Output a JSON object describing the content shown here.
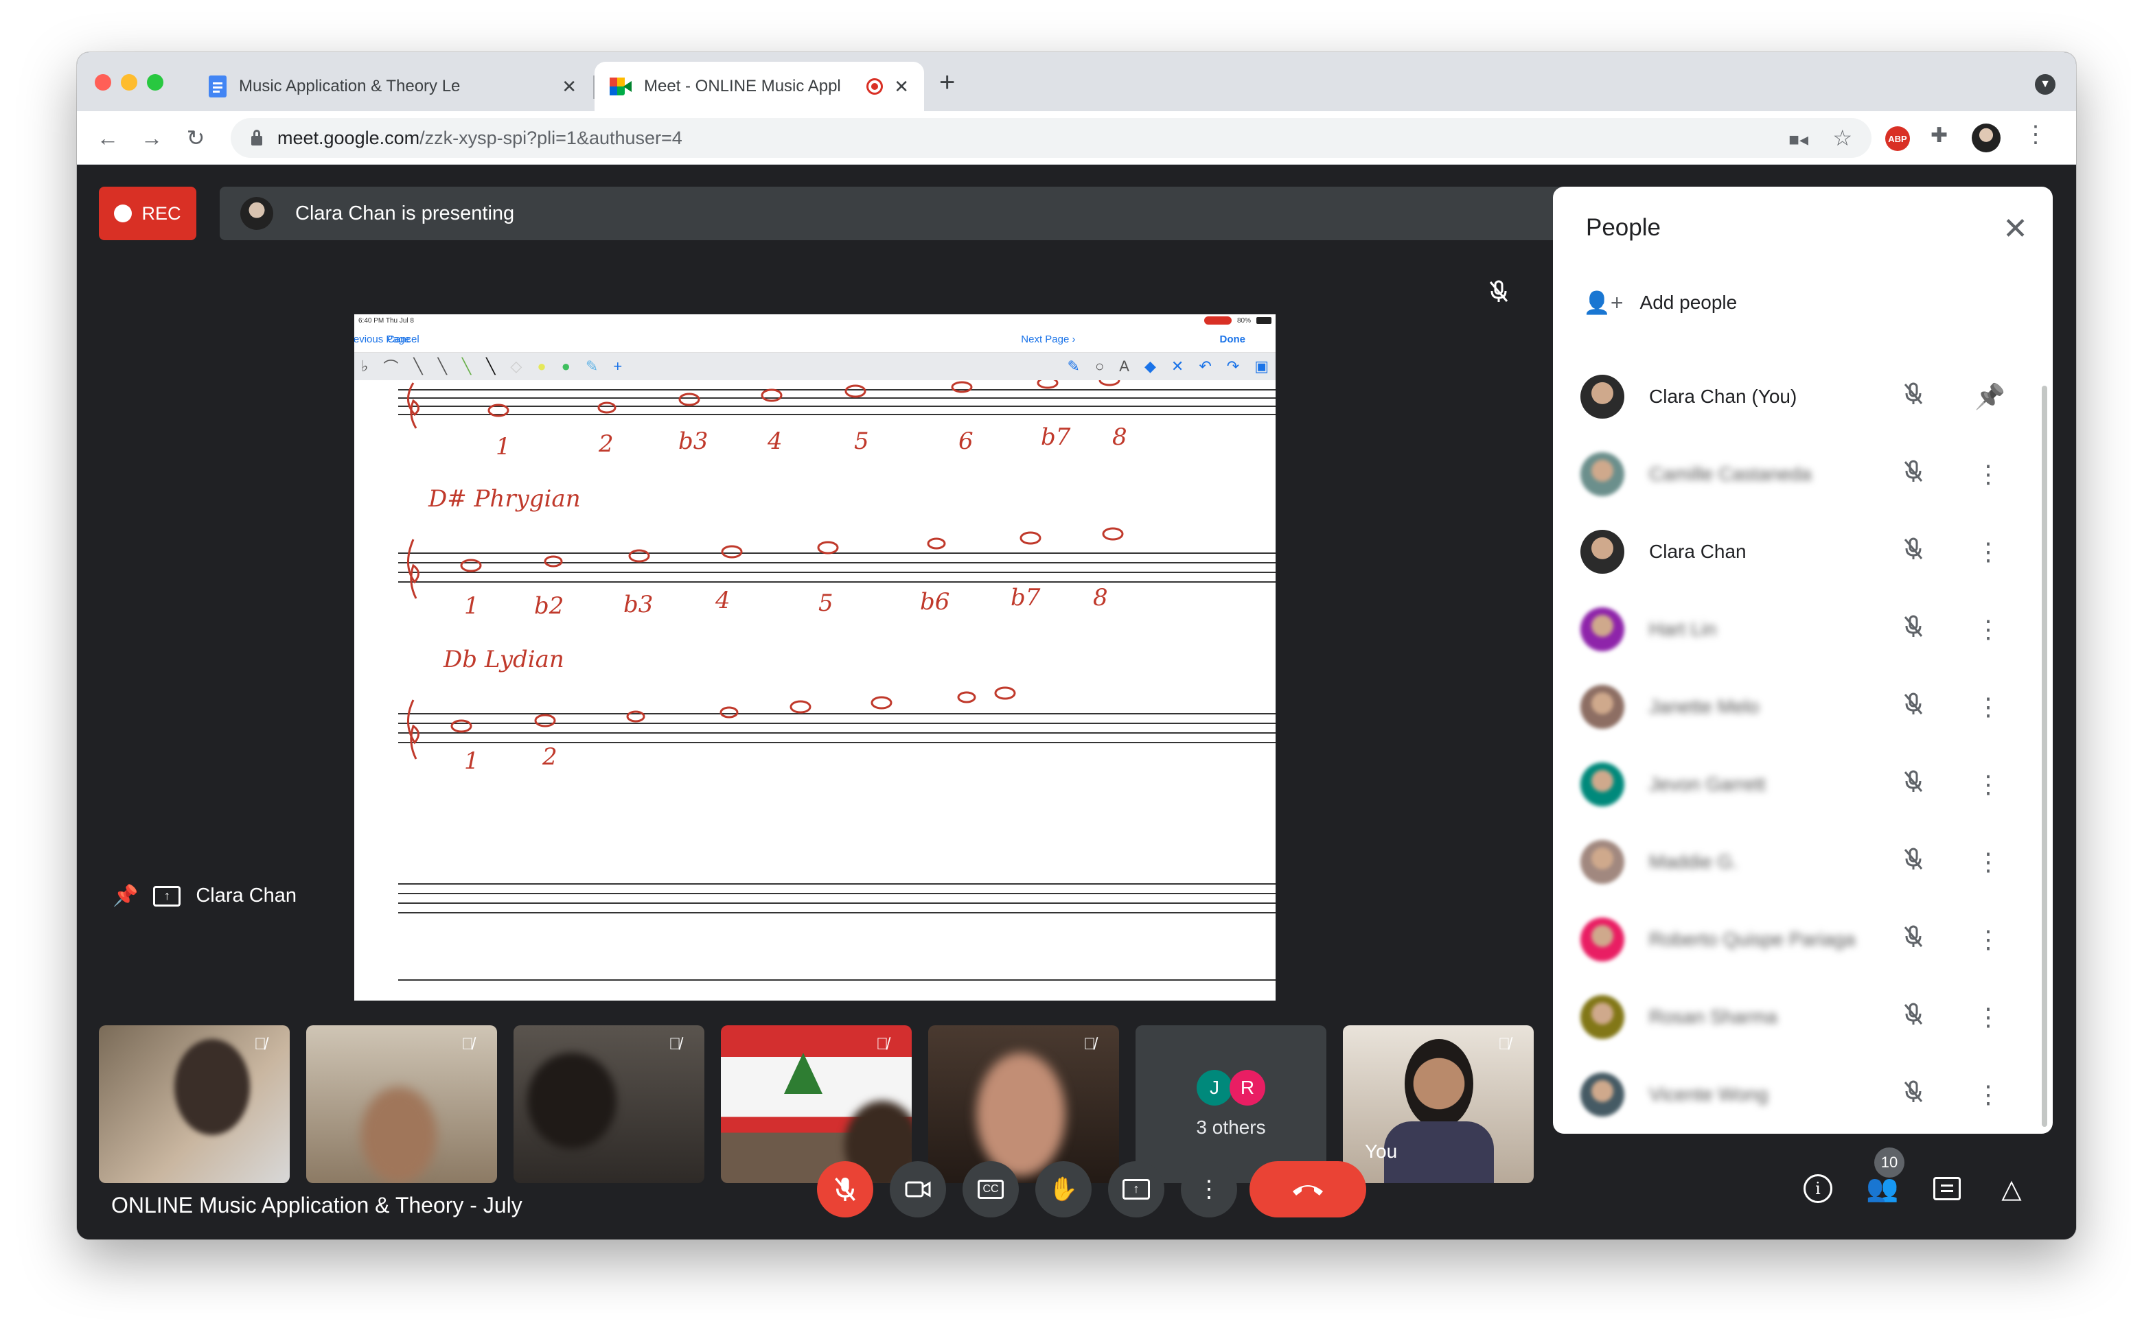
{
  "browser": {
    "tabs": [
      {
        "title": "Music Application & Theory Le",
        "icon": "docs-icon",
        "active": false
      },
      {
        "title": "Meet - ONLINE Music Appl",
        "icon": "meet-icon",
        "active": true
      }
    ],
    "new_tab": "+",
    "url_host": "meet.google.com",
    "url_path": "/zzk-xysp-spi?pli=1&authuser=4",
    "abp_label": "ABP"
  },
  "meet": {
    "rec_label": "REC",
    "presenting_text": "Clara Chan is presenting",
    "presenter_name": "Clara Chan",
    "meeting_title": "ONLINE Music Application & Theory - July",
    "participant_count": "10",
    "others": {
      "initials": [
        "J",
        "R"
      ],
      "label": "3 others"
    },
    "self_tile_label": "You",
    "slide": {
      "status_time": "6:40 PM  Thu Jul 8",
      "status_battery": "80%",
      "cancel": "Cancel",
      "previous": "Previous Page",
      "next": "Next Page",
      "done": "Done",
      "heading_phrygian": "D# Phrygian",
      "heading_lydian": "Db Lydian",
      "row1_degrees": [
        "1",
        "2",
        "b3",
        "4",
        "5",
        "6",
        "b7",
        "8"
      ],
      "row2_degrees": [
        "1",
        "b2",
        "b3",
        "4",
        "5",
        "b6",
        "b7",
        "8"
      ],
      "row3_degrees": [
        "1",
        "2"
      ]
    }
  },
  "people_panel": {
    "title": "People",
    "add_people": "Add people",
    "participants": [
      {
        "name": "Clara Chan (You)",
        "blurred": false,
        "color": "#2b2b2b",
        "action": "pin"
      },
      {
        "name": "Camille Castaneda",
        "blurred": true,
        "color": "#6b8f8c",
        "action": "more"
      },
      {
        "name": "Clara Chan",
        "blurred": false,
        "color": "#2b2b2b",
        "action": "more"
      },
      {
        "name": "Hart Lin",
        "blurred": true,
        "color": "#8e24aa",
        "action": "more"
      },
      {
        "name": "Janette Melo",
        "blurred": true,
        "color": "#8d6e63",
        "action": "more"
      },
      {
        "name": "Jevon Garrett",
        "blurred": true,
        "color": "#00897b",
        "action": "more"
      },
      {
        "name": "Maddie G.",
        "blurred": true,
        "color": "#a1887f",
        "action": "more"
      },
      {
        "name": "Roberto Quispe Pariaga",
        "blurred": true,
        "color": "#e91e63",
        "action": "more"
      },
      {
        "name": "Rosan Sharma",
        "blurred": true,
        "color": "#827717",
        "action": "more"
      },
      {
        "name": "Vicente Wong",
        "blurred": true,
        "color": "#455a64",
        "action": "more"
      }
    ]
  },
  "colors": {
    "meet_bg": "#202124",
    "danger": "#ea4335",
    "rec": "#d93025",
    "ink": "#c0392b",
    "link": "#1a73e8"
  }
}
